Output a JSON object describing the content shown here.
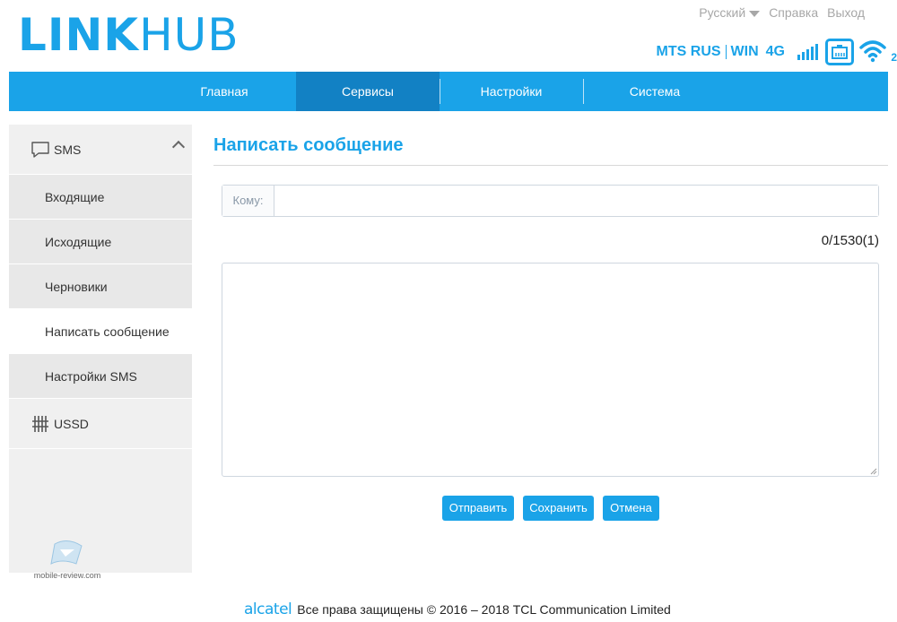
{
  "header": {
    "logo_bold": "LINK",
    "logo_light": "HUB",
    "language": "Русский",
    "help": "Справка",
    "logout": "Выход",
    "operator": "MTS RUS",
    "operator2": "WIN",
    "network_type": "4G",
    "wifi_clients": "2",
    "accent_color": "#1aa3e8"
  },
  "nav": {
    "items": [
      {
        "label": "Главная"
      },
      {
        "label": "Сервисы"
      },
      {
        "label": "Настройки"
      },
      {
        "label": "Система"
      }
    ],
    "active_index": 1
  },
  "sidebar": {
    "sms_label": "SMS",
    "items": [
      {
        "label": "Входящие"
      },
      {
        "label": "Исходящие"
      },
      {
        "label": "Черновики"
      },
      {
        "label": "Написать сообщение"
      },
      {
        "label": "Настройки SMS"
      }
    ],
    "ussd_label": "USSD",
    "watermark": "mobile-review.com"
  },
  "main": {
    "title": "Написать сообщение",
    "to_label": "Кому:",
    "to_value": "",
    "counter": "0/1530(1)",
    "message_value": "",
    "buttons": {
      "send": "Отправить",
      "save": "Сохранить",
      "cancel": "Отмена"
    }
  },
  "footer": {
    "brand": "alcatel",
    "copyright": "Все права защищены © 2016 – 2018 TCL Communication Limited"
  }
}
